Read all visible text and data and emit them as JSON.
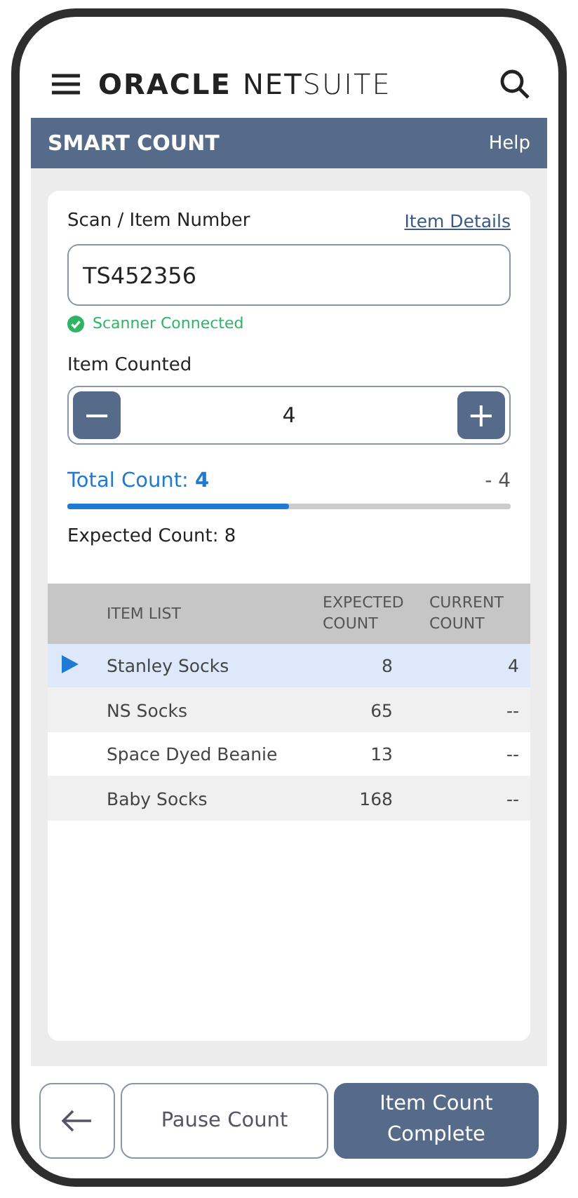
{
  "top_bar": {
    "logo_left": "ORACLE",
    "logo_right": "**NET**SUITE"
  },
  "title_bar": {
    "title": "SMART COUNT",
    "help": "Help"
  },
  "scan": {
    "label": "Scan / Item Number",
    "link": "Item Details",
    "value": "TS452356",
    "status": "Scanner Connected"
  },
  "counter": {
    "label": "Item Counted",
    "value": "4",
    "minus": "−",
    "plus": "+"
  },
  "progress": {
    "total": "Total Count: **4**",
    "difference": "- 4",
    "level": 0.5,
    "expected": "Expected Count: 8"
  },
  "table": {
    "columns": [
      "ITEM LIST",
      "EXPECTED COUNT",
      "CURRENT COUNT"
    ],
    "rows": [
      {
        "item": "Stanley Socks",
        "expected": "8",
        "current": "4",
        "selected": true
      },
      {
        "item": "NS Socks",
        "expected": "65",
        "current": "--",
        "selected": false
      },
      {
        "item": "Space Dyed Beanie",
        "expected": "13",
        "current": "--",
        "selected": false
      },
      {
        "item": "Baby Socks",
        "expected": "168",
        "current": "--",
        "selected": false
      }
    ]
  },
  "buttons": {
    "pause": "Pause Count",
    "complete": "Item Count Complete"
  }
}
